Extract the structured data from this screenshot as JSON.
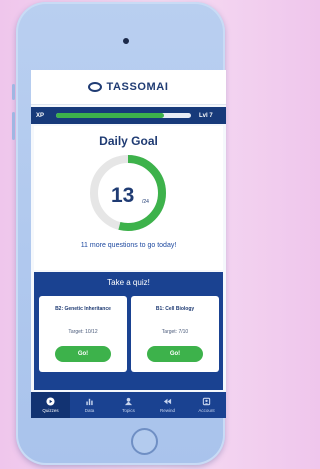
{
  "app": {
    "logo_text": "TASSOMAI"
  },
  "xp": {
    "label": "XP",
    "level_label": "Lvl 7",
    "progress": 0.8
  },
  "daily_goal": {
    "title": "Daily Goal",
    "done": "13",
    "total_label": "/24",
    "progress": 0.54,
    "remaining_text": "11 more questions to go today!"
  },
  "quiz": {
    "title": "Take a quiz!",
    "cards": [
      {
        "title": "B2: Genetic Inheritance",
        "target": "Target: 10/12",
        "button": "Go!"
      },
      {
        "title": "B1: Cell Biology",
        "target": "Target: 7/10",
        "button": "Go!"
      }
    ]
  },
  "tabs": [
    {
      "label": "Quizzes",
      "icon": "play-icon",
      "active": true
    },
    {
      "label": "Data",
      "icon": "bar-chart-icon",
      "active": false
    },
    {
      "label": "Topics",
      "icon": "topics-icon",
      "active": false
    },
    {
      "label": "Rewind",
      "icon": "rewind-icon",
      "active": false
    },
    {
      "label": "Account",
      "icon": "account-icon",
      "active": false
    }
  ],
  "colors": {
    "navy": "#1a4291",
    "green": "#3db24b",
    "ring_track": "#e6e6e6",
    "title_text": "#1f3b73"
  }
}
